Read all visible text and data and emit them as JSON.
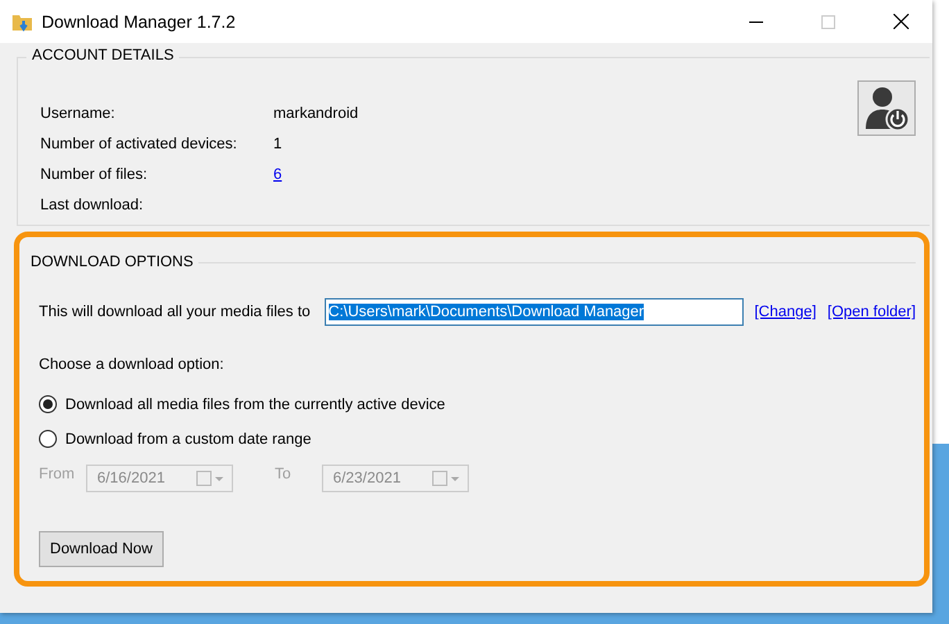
{
  "window": {
    "title": "Download Manager 1.7.2"
  },
  "account": {
    "heading": "ACCOUNT DETAILS",
    "rows": [
      {
        "label": "Username:",
        "value": "markandroid",
        "kind": "text"
      },
      {
        "label": "Number of activated devices:",
        "value": "1",
        "kind": "text"
      },
      {
        "label": "Number of files:",
        "value": "6",
        "kind": "link"
      },
      {
        "label": "Last download:"
      }
    ]
  },
  "options": {
    "heading": "DOWNLOAD OPTIONS",
    "path_label": "This will download all your media files to",
    "path_value": "C:\\Users\\mark\\Documents\\Download Manager",
    "links": [
      "[Change]",
      "[Open folder]"
    ],
    "choose_label": "Choose a download option:",
    "radios": [
      {
        "label": "Download all media files from the currently active device",
        "selected": true
      },
      {
        "label": "Download from a custom date range",
        "selected": false
      }
    ],
    "from_label": "From",
    "from_value": "6/16/2021",
    "to_label": "To",
    "to_value": "6/23/2021",
    "dates_disabled": true,
    "button": "Download Now"
  }
}
